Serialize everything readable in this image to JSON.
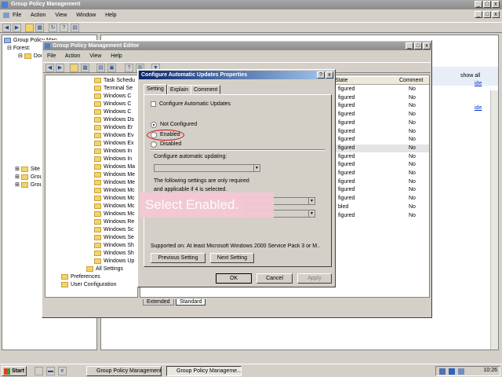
{
  "main_window": {
    "title": "Group Policy Management",
    "menu": [
      "File",
      "Action",
      "View",
      "Window",
      "Help"
    ],
    "tree": [
      "Group Policy Man",
      "Forest:",
      "Dor",
      "Site",
      "Grou",
      "Grou"
    ],
    "right_links": [
      "show all",
      "ide",
      "ide"
    ]
  },
  "editor_window": {
    "title": "Group Policy Management Editor",
    "menu": [
      "File",
      "Action",
      "View",
      "Help"
    ],
    "tree": [
      "Task Schedu",
      "Terminal Se",
      "Windows C",
      "Windows C",
      "Windows C",
      "Windows Ds",
      "Windows Er",
      "Windows Ev",
      "Windows Ex",
      "Windows In",
      "Windows In",
      "Windows Ma",
      "Windows Me",
      "Windows Me",
      "Windows Mc",
      "Windows Mc",
      "Windows Mc",
      "Windows Mc",
      "Windows Re",
      "Windows Sc",
      "Windows Se",
      "Windows Sh",
      "Windows Sh",
      "Windows Up"
    ],
    "tree_tail": {
      "all_settings": "All Settings",
      "preferences": "Preferences",
      "user_config": "User Configuration"
    },
    "column_state": "State",
    "column_comment": "Comment",
    "rows": [
      {
        "state": "figured",
        "comment": "No"
      },
      {
        "state": "figured",
        "comment": "No"
      },
      {
        "state": "figured",
        "comment": "No"
      },
      {
        "state": "figured",
        "comment": "No"
      },
      {
        "state": "figured",
        "comment": "No"
      },
      {
        "state": "figured",
        "comment": "No"
      },
      {
        "state": "figured",
        "comment": "No"
      },
      {
        "state": "figured",
        "comment": "No"
      },
      {
        "state": "figured",
        "comment": "No"
      },
      {
        "state": "figured",
        "comment": "No"
      },
      {
        "state": "figured",
        "comment": "No"
      },
      {
        "state": "figured",
        "comment": "No"
      },
      {
        "state": "figured",
        "comment": "No"
      },
      {
        "state": "figured",
        "comment": "No"
      },
      {
        "state": "bled",
        "comment": "No"
      },
      {
        "state": "figured",
        "comment": "No"
      }
    ],
    "bottom_tabs": [
      "Extended",
      "Standard"
    ]
  },
  "dialog": {
    "title": "Configure Automatic Updates Properties",
    "tabs": [
      "Setting",
      "Explain",
      "Comment"
    ],
    "setting_name": "Configure Automatic Updates",
    "radio_not_configured": "Not Configured",
    "radio_enabled": "Enabled",
    "radio_disabled": "Disabled",
    "configure_label": "Configure automatic updating:",
    "note_line1": "The following settings are only required",
    "note_line2": "and applicable if 4 is selected.",
    "supported_label": "Supported on:",
    "supported_value": "At least Microsoft Windows 2000 Service Pack 3 or M...",
    "prev_button": "Previous Setting",
    "next_button": "Next Setting",
    "ok_button": "OK",
    "cancel_button": "Cancel",
    "apply_button": "Apply"
  },
  "callout": {
    "text": "Select Enabled."
  },
  "taskbar": {
    "start": "Start",
    "tasks": [
      "Group Policy Management",
      "Group Policy Manageme..."
    ],
    "clock": "10:26"
  },
  "colors": {
    "highlight_circle": "#d01010",
    "callout_bg": "#f6c8d6",
    "callout_text": "#ffffff"
  }
}
